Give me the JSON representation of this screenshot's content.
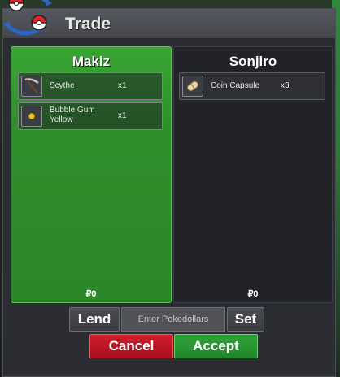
{
  "window": {
    "title": "Trade"
  },
  "left_panel": {
    "player_name": "Makiz",
    "items": [
      {
        "name": "Scythe",
        "qty": "x1",
        "icon": "scythe-icon"
      },
      {
        "name": "Bubble Gum Yellow",
        "qty": "x1",
        "icon": "bubble-gum-yellow-icon"
      }
    ],
    "money": "₽0",
    "accent": "#2f8f2c"
  },
  "right_panel": {
    "player_name": "Sonjiro",
    "items": [
      {
        "name": "Coin Capsule",
        "qty": "x3",
        "icon": "coin-capsule-icon"
      }
    ],
    "money": "₽0"
  },
  "controls": {
    "lend_label": "Lend",
    "money_placeholder": "Enter Pokedollars",
    "set_label": "Set",
    "cancel_label": "Cancel",
    "accept_label": "Accept",
    "cancel_color": "#c0182a",
    "accept_color": "#27963a"
  }
}
